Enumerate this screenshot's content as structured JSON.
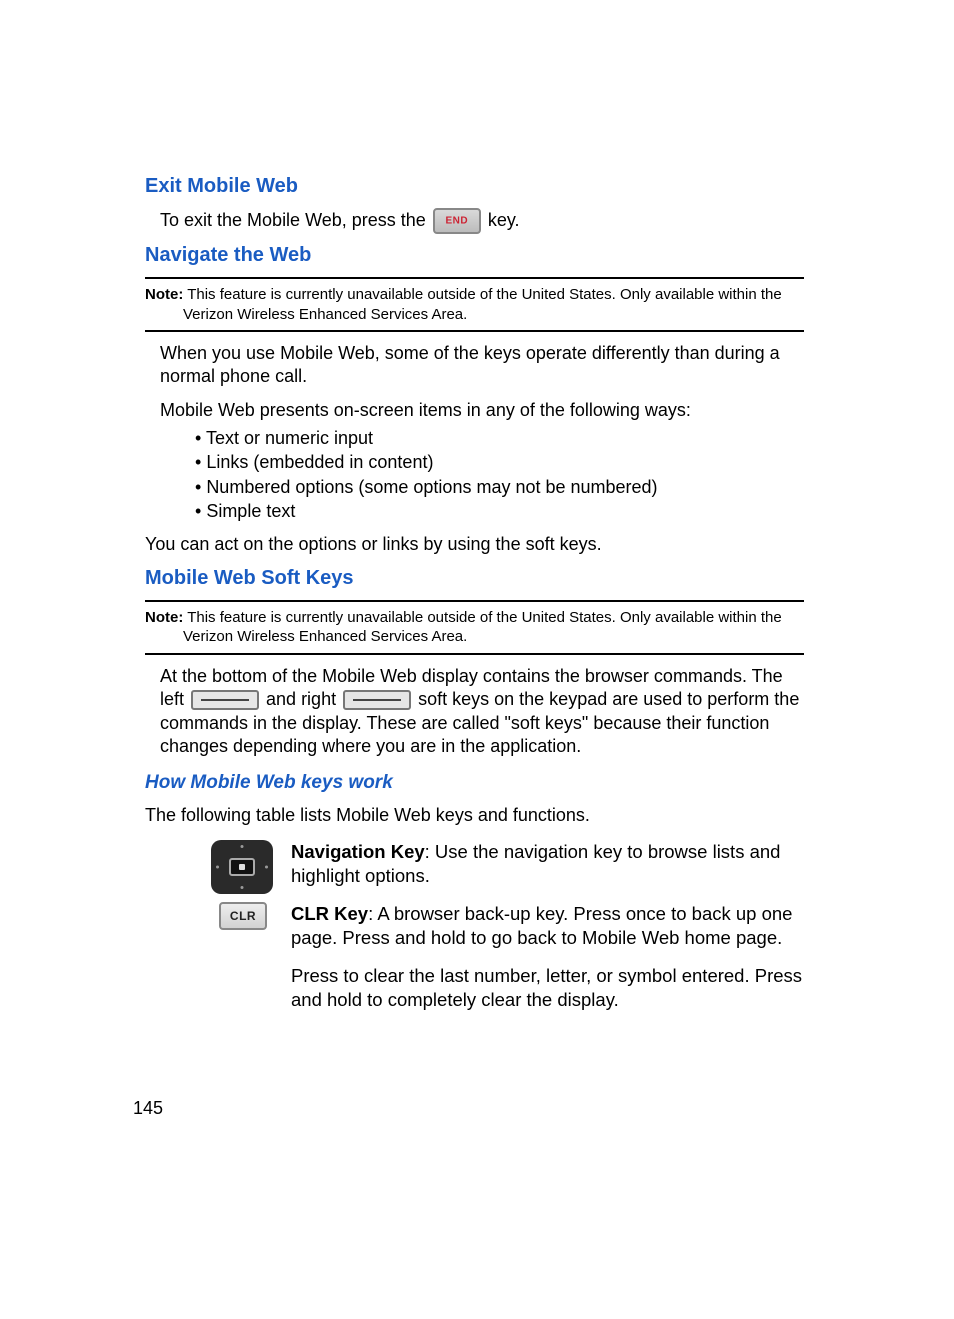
{
  "section1": {
    "heading": "Exit Mobile Web",
    "line_before": "To exit the Mobile Web, press the ",
    "line_after": " key."
  },
  "section2": {
    "heading": "Navigate the Web",
    "note_label": "Note:",
    "note_text": " This feature is currently unavailable outside of the United States. Only available within the Verizon Wireless Enhanced Services Area.",
    "para1": "When you use Mobile Web, some of the keys operate differently than during a normal phone call.",
    "para2": "Mobile Web presents on-screen items in any of the following ways:",
    "bullets": [
      "Text or numeric input",
      "Links (embedded in content)",
      "Numbered options (some options may not be numbered)",
      "Simple text"
    ],
    "para3": "You can act on the options or links by using the soft keys."
  },
  "section3": {
    "heading": "Mobile Web Soft Keys",
    "note_label": "Note:",
    "note_text": " This feature is currently unavailable outside of the United States. Only available within the Verizon Wireless Enhanced Services Area.",
    "para_before_left": "At the bottom of the Mobile Web display contains the browser commands. The left ",
    "para_mid": " and right ",
    "para_after_right": " soft keys on the keypad are used to perform the commands in the display. These are called \"soft keys\" because their function changes depending where you are in the application."
  },
  "section4": {
    "heading": "How Mobile Web keys work",
    "intro": "The following table lists Mobile Web keys and functions.",
    "rows": [
      {
        "name": "Navigation Key",
        "desc": ": Use the navigation key to browse lists and highlight options."
      },
      {
        "name": "CLR Key",
        "desc": ": A browser back-up key. Press once to back up one page. Press and hold to go back to Mobile Web home page.",
        "desc2": "Press to clear the last number, letter, or symbol entered. Press and hold to completely clear the display."
      }
    ],
    "clr_label": "CLR"
  },
  "page_number": "145"
}
